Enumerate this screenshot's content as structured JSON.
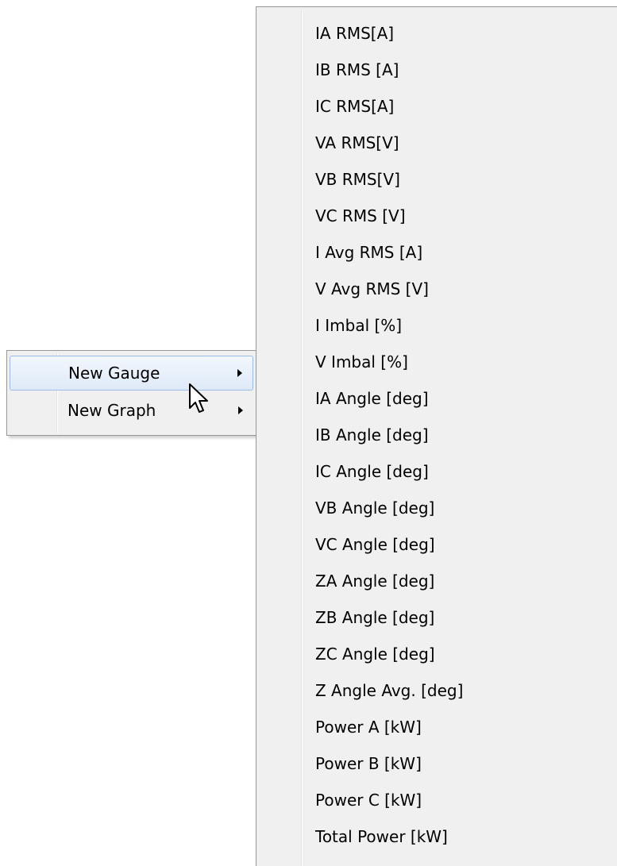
{
  "context_menu": {
    "items": [
      {
        "label": "New Gauge",
        "highlighted": true,
        "has_submenu": true
      },
      {
        "label": "New Graph",
        "highlighted": false,
        "has_submenu": true
      }
    ]
  },
  "submenu": {
    "items": [
      "IA RMS[A]",
      "IB RMS [A]",
      "IC RMS[A]",
      "VA RMS[V]",
      "VB RMS[V]",
      "VC RMS [V]",
      "I Avg RMS [A]",
      "V Avg RMS [V]",
      "I Imbal [%]",
      "V Imbal [%]",
      "IA Angle [deg]",
      "IB Angle [deg]",
      "IC Angle [deg]",
      "VB Angle [deg]",
      "VC Angle [deg]",
      "ZA Angle [deg]",
      "ZB Angle [deg]",
      "ZC Angle [deg]",
      "Z Angle Avg. [deg]",
      "Power A [kW]",
      "Power B [kW]",
      "Power C [kW]",
      "Total Power [kW]"
    ]
  },
  "cursor": {
    "icon": "arrow-pointer-icon"
  },
  "colors": {
    "menu_background": "#f0f0f0",
    "menu_border": "#979797",
    "highlight_border": "#9bbce8",
    "highlight_fill": "#dfeaf8"
  }
}
